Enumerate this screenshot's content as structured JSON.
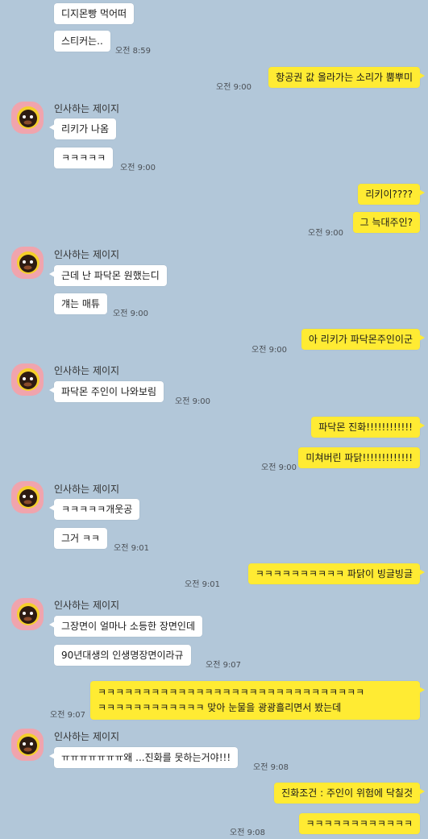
{
  "sender_name": "인사하는 제이지",
  "colors": {
    "background": "#b2c7d9",
    "incoming_bubble": "#ffffff",
    "outgoing_bubble": "#ffeb33",
    "avatar_bg": "#f0a4ad"
  },
  "messages": [
    {
      "side": "in",
      "text": "디지몬빵 먹어떠",
      "time": ""
    },
    {
      "side": "in",
      "text": "스티커는..",
      "time": "오전 8:59"
    },
    {
      "side": "out",
      "text": "항공권 값 올라가는 소리가 뿜뿌미",
      "time": "오전 9:00"
    },
    {
      "side": "in",
      "name": "인사하는 제이지",
      "text": "리키가 나옴",
      "time": ""
    },
    {
      "side": "in",
      "text": "ㅋㅋㅋㅋㅋ",
      "time": "오전 9:00"
    },
    {
      "side": "out",
      "text": "리키이????",
      "time": ""
    },
    {
      "side": "out",
      "text": "그 늑대주인?",
      "time": "오전 9:00"
    },
    {
      "side": "in",
      "name": "인사하는 제이지",
      "text": "근데 난 파닥몬 원했는디",
      "time": ""
    },
    {
      "side": "in",
      "text": "걔는 매튜",
      "time": "오전 9:00"
    },
    {
      "side": "out",
      "text": "아 리키가 파닥몬주인이군",
      "time": "오전 9:00"
    },
    {
      "side": "in",
      "name": "인사하는 제이지",
      "text": "파닥몬 주인이 나와보림",
      "time": "오전 9:00"
    },
    {
      "side": "out",
      "text": "파닥몬 진화!!!!!!!!!!!!",
      "time": ""
    },
    {
      "side": "out",
      "text": "미쳐버린 파닭!!!!!!!!!!!!!",
      "time": "오전 9:00"
    },
    {
      "side": "in",
      "name": "인사하는 제이지",
      "text": "ㅋㅋㅋㅋㅋ개웃공",
      "time": ""
    },
    {
      "side": "in",
      "text": "그거 ㅋㅋ",
      "time": "오전 9:01"
    },
    {
      "side": "out",
      "text": "ㅋㅋㅋㅋㅋㅋㅋㅋㅋㅋ 파닭이 빙글빙글",
      "time": "오전 9:01"
    },
    {
      "side": "in",
      "name": "인사하는 제이지",
      "text": "그장면이 얼마나 소등한 장면인데",
      "time": ""
    },
    {
      "side": "in",
      "text": "90년대생의  인생명장면이라규",
      "time": "오전 9:07"
    },
    {
      "side": "out",
      "text_line1": "ㅋㅋㅋㅋㅋㅋㅋㅋㅋㅋㅋㅋㅋㅋㅋㅋㅋㅋㅋㅋㅋㅋㅋㅋㅋㅋㅋㅋㅋㅋ",
      "text_line2": "ㅋㅋㅋㅋㅋㅋㅋㅋㅋㅋㅋㅋ 맞아 눈물을 광광흘리면서 봤는데",
      "time": "오전 9:07"
    },
    {
      "side": "in",
      "name": "인사하는 제이지",
      "text": "ㅠㅠㅠㅠㅠㅠㅠ왜 ...진화를 못하는거야!!!",
      "time": "오전 9:08"
    },
    {
      "side": "out",
      "text": "진화조건 : 주인이 위험에 닥칠것",
      "time": ""
    },
    {
      "side": "out",
      "text": "ㅋㅋㅋㅋㅋㅋㅋㅋㅋㅋㅋㅋ",
      "time": "오전 9:08"
    }
  ]
}
